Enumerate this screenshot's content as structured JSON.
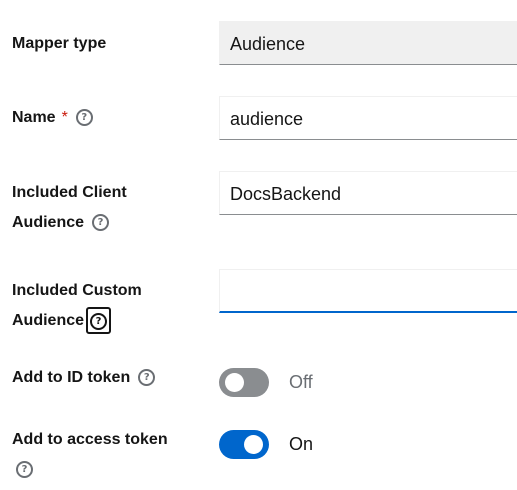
{
  "mapper_type": {
    "label": "Mapper type",
    "value": "Audience"
  },
  "name": {
    "label": "Name",
    "required_mark": "*",
    "value": "audience"
  },
  "included_client_audience": {
    "label_line1": "Included Client",
    "label_line2": "Audience",
    "value": "DocsBackend"
  },
  "included_custom_audience": {
    "label_line1": "Included Custom",
    "label_line2": "Audience",
    "value": ""
  },
  "add_to_id_token": {
    "label": "Add to ID token",
    "state": "Off",
    "enabled": false
  },
  "add_to_access_token": {
    "label": "Add to access token",
    "state": "On",
    "enabled": true
  },
  "icons": {
    "help": "help-circle-icon"
  },
  "colors": {
    "accent": "#0066cc",
    "required": "#c9190b",
    "readonly_bg": "#f0f0f0"
  }
}
